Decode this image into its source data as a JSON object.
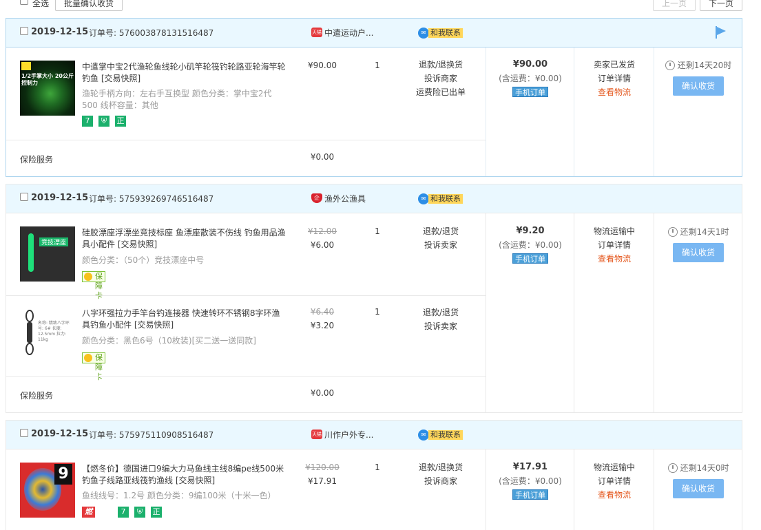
{
  "toolbar": {
    "select_all": "全选",
    "batch_confirm": "批量确认收货",
    "prev": "上一页",
    "next": "下一页"
  },
  "labels": {
    "order_no": "订单号:",
    "contact": "和我联系",
    "insurance": "保险服务",
    "insurance_price": "¥0.00",
    "mobile_order": "手机订单",
    "confirm_receipt": "确认收货",
    "order_detail": "订单详情",
    "view_logistics": "查看物流"
  },
  "orders": [
    {
      "date": "2019-12-15",
      "order_no": "576003878131516487",
      "shop": "中遣运动户...",
      "shop_badge": "天猫",
      "items": [
        {
          "title": "中遣掌中宝2代渔轮鱼线轮小矶竿轮筏钓轮路亚轮海竿轮钓鱼 [交易快照]",
          "attrs": "渔轮手柄方向：左右手互换型  颜色分类：掌中宝2代500  线杯容量：其他",
          "price": "¥90.00",
          "qty": "1",
          "ops": [
            "退款/退换货",
            "投诉商家",
            "运费险已出单"
          ],
          "thumb_text": "1/2手掌大小 20公斤控制力"
        }
      ],
      "total": "¥90.00",
      "shipping": "(含运费：¥0.00)",
      "status": "卖家已发货",
      "remaining": "还剩14天20时"
    },
    {
      "date": "2019-12-15",
      "order_no": "575939269746516487",
      "shop": "渔外公渔具",
      "shop_badge": "企",
      "items": [
        {
          "title": "硅胶漂座浮漂坐竞技标座 鱼漂座散装不伤线 钓鱼用品渔具小配件 [交易快照]",
          "attrs": "颜色分类：（50个）竞技漂座中号",
          "original_price": "¥12.00",
          "price": "¥6.00",
          "qty": "1",
          "ops": [
            "退款/退货",
            "投诉卖家"
          ],
          "guard": "保障卡",
          "thumb_text": "竞技漂座"
        },
        {
          "title": "八字环强拉力手竿台钓连接器 快速转环不锈钢8字环渔具钓鱼小配件 [交易快照]",
          "attrs": "颜色分类：黑色6号（10枚装)[买二送一送同款]",
          "original_price": "¥6.40",
          "price": "¥3.20",
          "qty": "1",
          "ops": [
            "退款/退货",
            "投诉卖家"
          ],
          "guard": "保障卡",
          "thumb_text": "名称: 精致八字环 号: 6# 长度: 12.5mm 拉力: 11kg"
        }
      ],
      "total": "¥9.20",
      "shipping": "(含运费：¥0.00)",
      "status": "物流运输中",
      "remaining": "还剩14天1时"
    },
    {
      "date": "2019-12-15",
      "order_no": "575975110908516487",
      "shop": "川作户外专...",
      "shop_badge": "天猫",
      "items": [
        {
          "title": "【燃冬价】德国进口9编大力马鱼线主线8编pe线500米钓鱼子线路亚线筏钓渔线 [交易快照]",
          "attrs": "鱼线线号：1.2号  颜色分类：9编100米（十米一色）",
          "original_price": "¥120.00",
          "price": "¥17.91",
          "qty": "1",
          "ops": [
            "退款/退换货",
            "投诉商家"
          ],
          "promo": "燃冬季",
          "thumb_text": "9"
        }
      ],
      "total": "¥17.91",
      "shipping": "(含运费：¥0.00)",
      "status": "物流运输中",
      "remaining": "还剩14天0时"
    }
  ],
  "icons": {
    "clock": "clock-icon",
    "flag": "flag-icon",
    "contact": "chat-icon"
  },
  "colors": {
    "header_bg": "#eaf8ff",
    "confirm_btn": "#79b7f2",
    "logistics": "#e4571d",
    "tag_green": "#1bb06c",
    "tmall_red": "#e4393c"
  }
}
